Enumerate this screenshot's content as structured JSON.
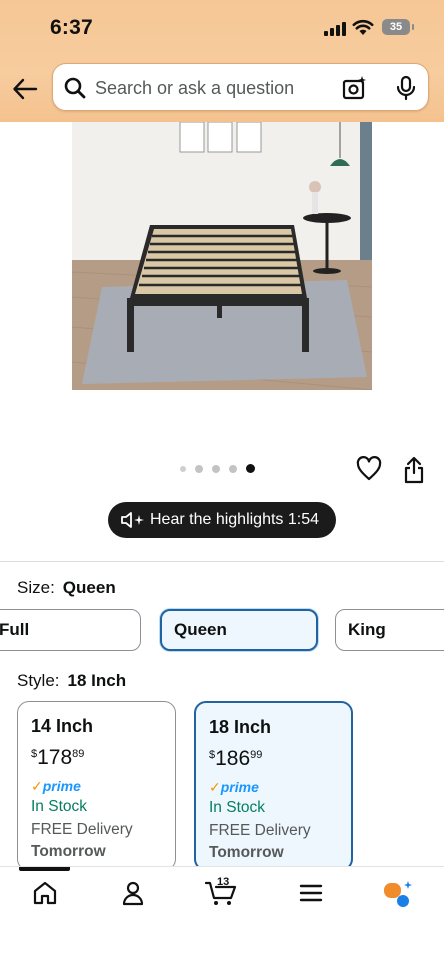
{
  "status_bar": {
    "time": "6:37",
    "battery": "35"
  },
  "header": {
    "search_placeholder": "Search or ask a question"
  },
  "gallery": {
    "page_count": 5,
    "active_index": 4
  },
  "highlights": {
    "label": "Hear the highlights 1:54"
  },
  "size": {
    "label": "Size:",
    "value": "Queen",
    "options": [
      "Full",
      "Queen",
      "King"
    ],
    "selected": "Queen"
  },
  "style": {
    "label": "Style:",
    "value": "18 Inch",
    "options": [
      {
        "name": "14 Inch",
        "price_whole": "178",
        "price_cents": "89",
        "currency": "$",
        "prime_check": "✓",
        "prime": "prime",
        "stock": "In Stock",
        "delivery": "FREE Delivery",
        "when": "Tomorrow"
      },
      {
        "name": "18 Inch",
        "price_whole": "186",
        "price_cents": "99",
        "currency": "$",
        "prime_check": "✓",
        "prime": "prime",
        "stock": "In Stock",
        "delivery": "FREE Delivery",
        "when": "Tomorrow"
      }
    ]
  },
  "nav": {
    "cart_count": "13",
    "items": [
      "home-icon",
      "account-icon",
      "cart-icon",
      "menu-icon",
      "rufus-icon"
    ]
  },
  "colors": {
    "accent": "#2162a1",
    "prime": "#1a98ff",
    "stock": "#067d62",
    "header": "#f6c795"
  }
}
